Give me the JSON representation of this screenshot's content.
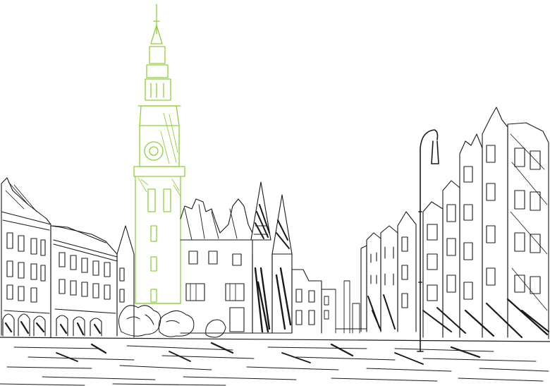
{
  "scene": {
    "kind": "pen-sketch",
    "subject": "old-town-market-square",
    "ink_color": "#1a1a1a",
    "accent_color": "#8fd13a",
    "background_color": "#ffffff"
  },
  "elements": [
    "tower-spire",
    "town-hall-tower",
    "town-hall-gables",
    "left-building-row",
    "right-building-row",
    "distant-buildings",
    "street-lamp",
    "trees",
    "cobblestone-square"
  ]
}
